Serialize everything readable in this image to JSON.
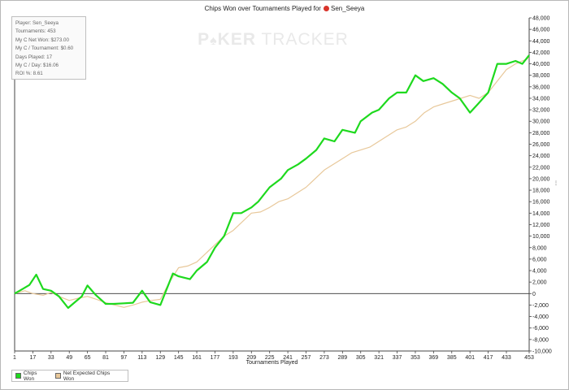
{
  "title": "Chips Won over Tournaments Played for",
  "player_name": "Sen_Seeya",
  "watermark": {
    "left": "P",
    "mid": "KER",
    "right": "TRACKER"
  },
  "stats": [
    "Player: Sen_Seeya",
    "Tournaments: 453",
    "My C Net Won: $273.00",
    "My C / Tournament: $0.60",
    "Days Played: 17",
    "My C / Day: $16.06",
    "ROI %: 8.61"
  ],
  "legend": [
    {
      "label": "Chips Won",
      "color": "#1ed91e"
    },
    {
      "label": "Net Expected Chips Won",
      "color": "#e8c89a"
    }
  ],
  "chart_data": {
    "type": "line",
    "xlabel": "Tournaments Played",
    "ylabel": "",
    "xlim": [
      1,
      453
    ],
    "ylim": [
      -10000,
      48000
    ],
    "x_ticks": [
      1,
      17,
      33,
      49,
      65,
      81,
      97,
      113,
      129,
      145,
      161,
      177,
      193,
      209,
      225,
      241,
      257,
      273,
      289,
      305,
      321,
      337,
      353,
      369,
      385,
      401,
      417,
      433,
      453
    ],
    "y_ticks": [
      "-10,000",
      "-8,000",
      "-6,000",
      "-4,000",
      "-2,000",
      "0",
      "2,000",
      "4,000",
      "6,000",
      "8,000",
      "10,000",
      "12,000",
      "14,000",
      "16,000",
      "18,000",
      "20,000",
      "22,000",
      "24,000",
      "26,000",
      "28,000",
      "30,000",
      "32,000",
      "34,000",
      "36,000",
      "38,000",
      "40,000",
      "42,000",
      "44,000",
      "46,000",
      "48,000"
    ],
    "y_tick_values": [
      -10000,
      -8000,
      -6000,
      -4000,
      -2000,
      0,
      2000,
      4000,
      6000,
      8000,
      10000,
      12000,
      14000,
      16000,
      18000,
      20000,
      22000,
      24000,
      26000,
      28000,
      30000,
      32000,
      34000,
      36000,
      38000,
      40000,
      42000,
      44000,
      46000,
      48000
    ],
    "series": [
      {
        "name": "Chips Won",
        "color": "#1ed91e",
        "points": [
          [
            1,
            0
          ],
          [
            8,
            800
          ],
          [
            14,
            1500
          ],
          [
            20,
            3300
          ],
          [
            26,
            800
          ],
          [
            33,
            500
          ],
          [
            40,
            -500
          ],
          [
            48,
            -2500
          ],
          [
            54,
            -1500
          ],
          [
            60,
            -500
          ],
          [
            65,
            1400
          ],
          [
            72,
            -200
          ],
          [
            81,
            -1800
          ],
          [
            88,
            -1800
          ],
          [
            97,
            -1700
          ],
          [
            105,
            -1600
          ],
          [
            113,
            500
          ],
          [
            120,
            -1500
          ],
          [
            129,
            -2000
          ],
          [
            135,
            1000
          ],
          [
            140,
            3500
          ],
          [
            145,
            3000
          ],
          [
            155,
            2500
          ],
          [
            161,
            4000
          ],
          [
            170,
            5500
          ],
          [
            177,
            8000
          ],
          [
            185,
            10000
          ],
          [
            193,
            14000
          ],
          [
            200,
            14000
          ],
          [
            209,
            15000
          ],
          [
            215,
            16000
          ],
          [
            225,
            18500
          ],
          [
            235,
            20000
          ],
          [
            241,
            21500
          ],
          [
            250,
            22500
          ],
          [
            257,
            23500
          ],
          [
            266,
            25000
          ],
          [
            273,
            27000
          ],
          [
            282,
            26500
          ],
          [
            289,
            28500
          ],
          [
            300,
            28000
          ],
          [
            305,
            30000
          ],
          [
            315,
            31500
          ],
          [
            321,
            32000
          ],
          [
            330,
            34000
          ],
          [
            337,
            35000
          ],
          [
            345,
            35000
          ],
          [
            353,
            38000
          ],
          [
            360,
            37000
          ],
          [
            369,
            37500
          ],
          [
            377,
            36500
          ],
          [
            385,
            35000
          ],
          [
            392,
            34000
          ],
          [
            401,
            31500
          ],
          [
            408,
            33000
          ],
          [
            417,
            35000
          ],
          [
            425,
            40000
          ],
          [
            433,
            40000
          ],
          [
            441,
            40500
          ],
          [
            447,
            40000
          ],
          [
            453,
            41500
          ]
        ]
      },
      {
        "name": "Net Expected Chips Won",
        "color": "#e8c89a",
        "points": [
          [
            1,
            0
          ],
          [
            10,
            500
          ],
          [
            17,
            0
          ],
          [
            26,
            -300
          ],
          [
            33,
            200
          ],
          [
            40,
            -500
          ],
          [
            49,
            -1200
          ],
          [
            57,
            -800
          ],
          [
            65,
            -500
          ],
          [
            73,
            -1000
          ],
          [
            81,
            -1600
          ],
          [
            89,
            -2000
          ],
          [
            97,
            -2400
          ],
          [
            105,
            -2000
          ],
          [
            113,
            -1500
          ],
          [
            121,
            -1200
          ],
          [
            129,
            -1000
          ],
          [
            137,
            2000
          ],
          [
            145,
            4500
          ],
          [
            153,
            4800
          ],
          [
            161,
            5500
          ],
          [
            169,
            7000
          ],
          [
            177,
            8500
          ],
          [
            185,
            10000
          ],
          [
            193,
            11000
          ],
          [
            201,
            12500
          ],
          [
            209,
            14000
          ],
          [
            217,
            14200
          ],
          [
            225,
            15000
          ],
          [
            233,
            16000
          ],
          [
            241,
            16500
          ],
          [
            249,
            17500
          ],
          [
            257,
            18500
          ],
          [
            265,
            20000
          ],
          [
            273,
            21500
          ],
          [
            281,
            22500
          ],
          [
            289,
            23500
          ],
          [
            297,
            24500
          ],
          [
            305,
            25000
          ],
          [
            313,
            25500
          ],
          [
            321,
            26500
          ],
          [
            329,
            27500
          ],
          [
            337,
            28500
          ],
          [
            345,
            29000
          ],
          [
            353,
            30000
          ],
          [
            361,
            31500
          ],
          [
            369,
            32500
          ],
          [
            377,
            33000
          ],
          [
            385,
            33500
          ],
          [
            393,
            34000
          ],
          [
            401,
            34500
          ],
          [
            409,
            34000
          ],
          [
            417,
            35000
          ],
          [
            425,
            37000
          ],
          [
            433,
            39000
          ],
          [
            441,
            40000
          ],
          [
            447,
            40500
          ],
          [
            453,
            41000
          ]
        ]
      }
    ]
  }
}
